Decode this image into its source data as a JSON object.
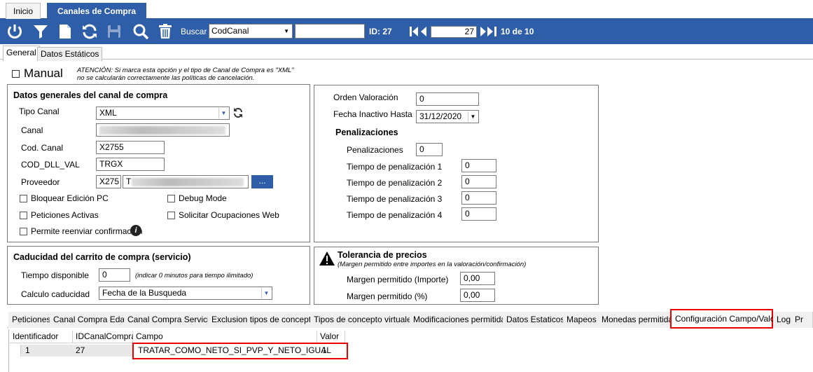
{
  "tabs": [
    {
      "label": "Inicio"
    },
    {
      "label": "Canales de Compra"
    }
  ],
  "toolbar": {
    "buscar_label": "Buscar",
    "search_field": "CodCanal",
    "id_label": "ID: 27",
    "record_number": "27",
    "record_count": "10 de 10"
  },
  "subtabs": [
    {
      "label": "General"
    },
    {
      "label": "Datos Estáticos"
    }
  ],
  "manual": {
    "label": "Manual",
    "warning_line1": "ATENCIÓN: Si marca esta opción y el tipo de Canal de Compra es \"XML\"",
    "warning_line2": "no se calcularán correctamente las políticas de cancelación."
  },
  "general": {
    "title": "Datos generales del canal de compra",
    "tipo_canal_label": "Tipo Canal",
    "tipo_canal_value": "XML",
    "canal_label": "Canal",
    "cod_canal_label": "Cod. Canal",
    "cod_canal_value": "X2755",
    "cod_dll_label": "COD_DLL_VAL",
    "cod_dll_value": "TRGX",
    "proveedor_label": "Proveedor",
    "proveedor_code": "X275",
    "proveedor_name": "T",
    "proveedor_button": "...",
    "bloquear_label": "Bloquear Edición PC",
    "debug_label": "Debug Mode",
    "peticiones_label": "Peticiones Activas",
    "solicitar_label": "Solicitar Ocupaciones Web",
    "reenviar_label": "Permite reenviar confirmación"
  },
  "valoracion": {
    "orden_label": "Orden Valoración",
    "orden_value": "0",
    "fecha_label": "Fecha Inactivo Hasta",
    "fecha_value": "31/12/2020",
    "pen_title": "Penalizaciones",
    "pen_label": "Penalizaciones",
    "pen_value": "0",
    "tiempos": [
      {
        "label": "Tiempo de penalización 1",
        "value": "0"
      },
      {
        "label": "Tiempo de penalización 2",
        "value": "0"
      },
      {
        "label": "Tiempo de penalización 3",
        "value": "0"
      },
      {
        "label": "Tiempo de penalización 4",
        "value": "0"
      }
    ]
  },
  "caducidad": {
    "title": "Caducidad del carrito de compra (servicio)",
    "tiempo_label": "Tiempo disponible",
    "tiempo_value": "0",
    "tiempo_hint": "(indicar 0 minutos para tiempo ilimitado)",
    "calculo_label": "Calculo caducidad",
    "calculo_value": "Fecha de la Busqueda"
  },
  "tolerancia": {
    "title": "Tolerancia de precios",
    "subtitle": "(Margen permitido entre importes en la valoración/confirmación)",
    "importe_label": "Margen permitido (Importe)",
    "importe_value": "0,00",
    "pct_label": "Margen permitido (%)",
    "pct_value": "0,00"
  },
  "bottom_tabs": [
    {
      "label": "Peticiones"
    },
    {
      "label": "Canal Compra Edad"
    },
    {
      "label": "Canal Compra Servicio"
    },
    {
      "label": "Exclusion tipos de concepto"
    },
    {
      "label": "Tipos de concepto virtuales"
    },
    {
      "label": "Modificaciones permitidas"
    },
    {
      "label": "Datos Estaticos"
    },
    {
      "label": "Mapeos"
    },
    {
      "label": "Monedas permitidas"
    },
    {
      "label": "Configuración Campo/Valor"
    },
    {
      "label": "Log"
    },
    {
      "label": "Pr"
    }
  ],
  "grid": {
    "headers": [
      "Identificador",
      "IDCanalCompra",
      "Campo",
      "Valor"
    ],
    "rows": [
      {
        "id": "1",
        "idcanal": "27",
        "campo": "TRATAR_COMO_NETO_SI_PVP_Y_NETO_IGUAL",
        "valor": "1"
      }
    ]
  },
  "colors": {
    "accent": "#2f5ea8",
    "highlight": "#e00000"
  }
}
